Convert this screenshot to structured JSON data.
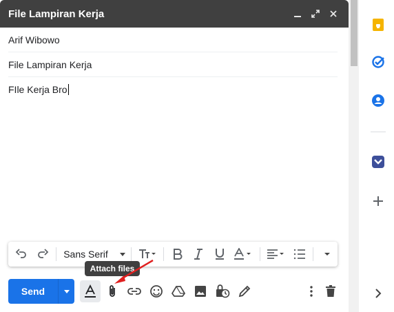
{
  "compose": {
    "title": "File Lampiran Kerja",
    "to": "Arif Wibowo",
    "subject": "File Lampiran Kerja",
    "body": "FIle Kerja Bro"
  },
  "toolbar": {
    "font": "Sans Serif"
  },
  "bottom": {
    "send_label": "Send"
  },
  "tooltip": "Attach files",
  "icons": {
    "titlebar": [
      "minimize-icon",
      "expand-icon",
      "close-icon"
    ],
    "format": [
      "undo-icon",
      "redo-icon",
      "font-size-icon",
      "bold-icon",
      "italic-icon",
      "underline-icon",
      "text-color-icon",
      "align-icon",
      "numbered-list-icon",
      "more-formatting-icon"
    ],
    "bottom": [
      "formatting-options-icon",
      "attach-icon",
      "link-icon",
      "emoji-icon",
      "drive-icon",
      "photo-icon",
      "confidential-icon",
      "signature-icon",
      "more-options-icon",
      "trash-icon"
    ],
    "side": [
      "keep-icon",
      "tasks-icon",
      "contacts-icon",
      "addon-icon",
      "add-icon",
      "chevron-right-icon"
    ]
  },
  "colors": {
    "titlebar": "#404040",
    "send": "#1a73e8",
    "keep": "#f5b400",
    "tasks": "#1a73e8",
    "contacts": "#1a73e8",
    "addon": "#3d4f9a",
    "arrow": "#e02020"
  }
}
